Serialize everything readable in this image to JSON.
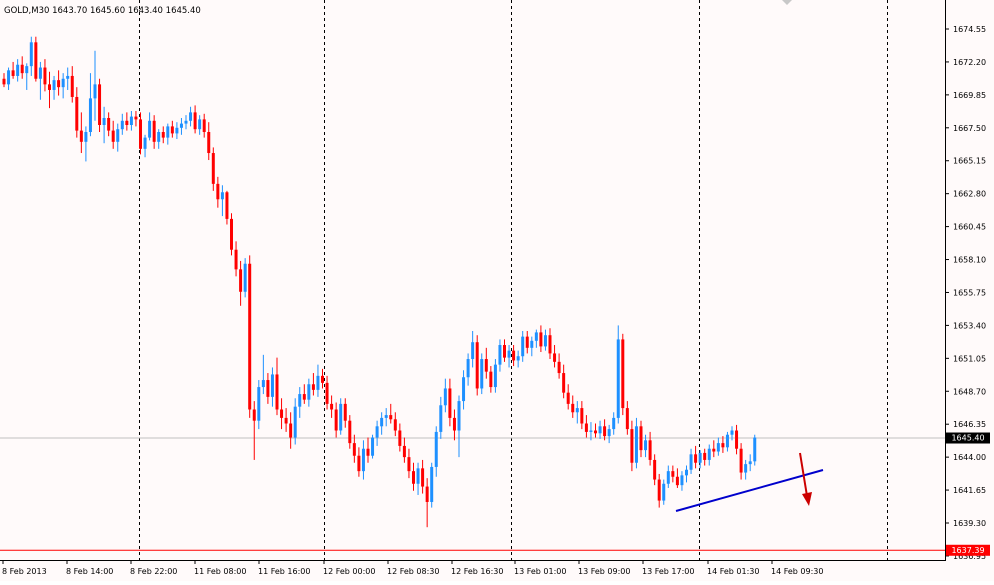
{
  "chart_data": {
    "type": "candlestick",
    "symbol_header": "GOLD,M30  1643.70 1645.60 1643.40 1645.40",
    "x_tick_labels": [
      "8 Feb 2013",
      "8 Feb 14:00",
      "8 Feb 22:00",
      "11 Feb 08:00",
      "11 Feb 16:00",
      "12 Feb 00:00",
      "12 Feb 08:30",
      "12 Feb 16:30",
      "13 Feb 01:00",
      "13 Feb 09:00",
      "13 Feb 17:00",
      "14 Feb 01:30",
      "14 Feb 09:30"
    ],
    "y_tick_labels": [
      "1674.55",
      "1672.20",
      "1669.85",
      "1667.50",
      "1665.15",
      "1662.80",
      "1660.45",
      "1658.10",
      "1655.75",
      "1653.40",
      "1651.05",
      "1648.70",
      "1646.35",
      "1644.00",
      "1641.65",
      "1639.30",
      "1636.95"
    ],
    "ylim": [
      1636.55,
      1676.1
    ],
    "current_price": 1645.4,
    "current_price_label": "1645.40",
    "red_level": 1637.39,
    "red_level_label": "1637.39",
    "grid": "vertical-dotted",
    "colors": {
      "background": "#fffafa",
      "bull": "#1e90ff",
      "bear": "#ff0000",
      "price_line": "#c0c0c0",
      "red_line": "#ff0000",
      "trendline": "#0000cc",
      "arrow": "#cc0000"
    },
    "candles": [
      [
        1671.0,
        1671.4,
        1670.4,
        1670.6
      ],
      [
        1670.6,
        1671.8,
        1670.2,
        1671.6
      ],
      [
        1671.6,
        1672.2,
        1671.0,
        1671.2
      ],
      [
        1671.2,
        1672.4,
        1670.8,
        1672.0
      ],
      [
        1672.0,
        1672.6,
        1671.0,
        1671.4
      ],
      [
        1671.4,
        1672.1,
        1670.2,
        1671.9
      ],
      [
        1671.9,
        1674.0,
        1671.2,
        1673.6
      ],
      [
        1673.6,
        1674.0,
        1670.8,
        1671.0
      ],
      [
        1671.0,
        1672.2,
        1669.5,
        1671.8
      ],
      [
        1671.8,
        1672.4,
        1670.1,
        1670.6
      ],
      [
        1670.6,
        1671.5,
        1668.9,
        1670.2
      ],
      [
        1670.2,
        1671.2,
        1669.5,
        1670.9
      ],
      [
        1670.9,
        1671.6,
        1669.8,
        1670.4
      ],
      [
        1670.4,
        1671.4,
        1669.6,
        1671.0
      ],
      [
        1671.0,
        1671.8,
        1670.2,
        1671.2
      ],
      [
        1671.2,
        1671.9,
        1669.3,
        1669.7
      ],
      [
        1669.7,
        1670.4,
        1666.8,
        1667.3
      ],
      [
        1667.3,
        1668.6,
        1665.7,
        1666.5
      ],
      [
        1666.5,
        1667.6,
        1665.1,
        1667.2
      ],
      [
        1667.2,
        1671.4,
        1666.9,
        1669.6
      ],
      [
        1669.6,
        1673.0,
        1668.0,
        1670.6
      ],
      [
        1670.6,
        1671.0,
        1667.2,
        1667.7
      ],
      [
        1667.7,
        1669.0,
        1666.4,
        1668.2
      ],
      [
        1668.2,
        1668.6,
        1666.9,
        1667.3
      ],
      [
        1667.3,
        1668.0,
        1666.0,
        1666.5
      ],
      [
        1666.5,
        1667.8,
        1665.8,
        1667.4
      ],
      [
        1667.4,
        1668.5,
        1667.0,
        1668.0
      ],
      [
        1668.0,
        1668.6,
        1667.3,
        1667.7
      ],
      [
        1667.7,
        1668.7,
        1667.3,
        1668.3
      ],
      [
        1668.3,
        1668.7,
        1667.6,
        1668.1
      ],
      [
        1668.1,
        1668.6,
        1665.6,
        1666.0
      ],
      [
        1666.0,
        1667.0,
        1665.4,
        1666.8
      ],
      [
        1666.8,
        1668.6,
        1666.6,
        1668.0
      ],
      [
        1668.0,
        1668.4,
        1666.0,
        1666.5
      ],
      [
        1666.5,
        1667.4,
        1666.0,
        1667.2
      ],
      [
        1667.2,
        1667.6,
        1666.4,
        1666.8
      ],
      [
        1666.8,
        1667.8,
        1666.3,
        1667.6
      ],
      [
        1667.6,
        1668.0,
        1666.8,
        1667.1
      ],
      [
        1667.1,
        1667.9,
        1666.7,
        1667.5
      ],
      [
        1667.5,
        1668.2,
        1667.0,
        1667.8
      ],
      [
        1667.8,
        1668.4,
        1667.4,
        1668.0
      ],
      [
        1668.0,
        1669.0,
        1667.6,
        1668.6
      ],
      [
        1668.6,
        1669.1,
        1667.1,
        1667.4
      ],
      [
        1667.4,
        1668.4,
        1667.0,
        1668.1
      ],
      [
        1668.1,
        1668.5,
        1666.8,
        1667.2
      ],
      [
        1667.2,
        1667.9,
        1665.2,
        1665.7
      ],
      [
        1665.7,
        1666.1,
        1663.0,
        1663.5
      ],
      [
        1663.5,
        1664.0,
        1661.8,
        1662.4
      ],
      [
        1662.4,
        1663.4,
        1661.2,
        1662.9
      ],
      [
        1662.9,
        1663.0,
        1660.6,
        1661.0
      ],
      [
        1661.0,
        1661.4,
        1658.4,
        1658.8
      ],
      [
        1658.8,
        1659.4,
        1656.9,
        1657.4
      ],
      [
        1657.4,
        1658.0,
        1654.8,
        1655.8
      ],
      [
        1655.8,
        1658.2,
        1655.4,
        1657.8
      ],
      [
        1657.8,
        1658.4,
        1646.8,
        1647.4
      ],
      [
        1647.4,
        1648.0,
        1643.8,
        1646.6
      ],
      [
        1646.6,
        1649.5,
        1646.0,
        1649.0
      ],
      [
        1649.0,
        1651.3,
        1648.5,
        1649.5
      ],
      [
        1649.5,
        1650.0,
        1647.8,
        1648.3
      ],
      [
        1648.3,
        1650.4,
        1647.6,
        1649.9
      ],
      [
        1649.9,
        1651.1,
        1647.0,
        1647.4
      ],
      [
        1647.4,
        1648.2,
        1646.0,
        1646.8
      ],
      [
        1646.8,
        1647.5,
        1645.8,
        1646.4
      ],
      [
        1646.4,
        1647.2,
        1644.6,
        1645.4
      ],
      [
        1645.4,
        1648.2,
        1644.9,
        1647.6
      ],
      [
        1647.6,
        1649.0,
        1646.8,
        1648.5
      ],
      [
        1648.5,
        1649.2,
        1647.8,
        1648.1
      ],
      [
        1648.1,
        1649.6,
        1647.6,
        1649.2
      ],
      [
        1649.2,
        1650.0,
        1648.4,
        1648.8
      ],
      [
        1648.8,
        1650.6,
        1648.3,
        1649.8
      ],
      [
        1649.8,
        1650.3,
        1648.9,
        1649.3
      ],
      [
        1649.3,
        1649.8,
        1647.4,
        1647.8
      ],
      [
        1647.8,
        1648.4,
        1646.8,
        1647.4
      ],
      [
        1647.4,
        1647.9,
        1645.4,
        1645.9
      ],
      [
        1645.9,
        1648.2,
        1645.6,
        1647.8
      ],
      [
        1647.8,
        1648.2,
        1646.1,
        1646.6
      ],
      [
        1646.6,
        1647.0,
        1644.6,
        1645.0
      ],
      [
        1645.0,
        1645.6,
        1643.6,
        1644.1
      ],
      [
        1644.1,
        1644.7,
        1642.6,
        1643.0
      ],
      [
        1643.0,
        1645.2,
        1642.4,
        1644.6
      ],
      [
        1644.6,
        1645.4,
        1643.6,
        1644.1
      ],
      [
        1644.1,
        1645.6,
        1643.9,
        1645.4
      ],
      [
        1645.4,
        1646.6,
        1644.8,
        1646.2
      ],
      [
        1646.2,
        1647.2,
        1645.6,
        1646.8
      ],
      [
        1646.8,
        1647.5,
        1646.2,
        1647.0
      ],
      [
        1647.0,
        1647.8,
        1646.4,
        1646.7
      ],
      [
        1646.7,
        1647.2,
        1645.5,
        1645.9
      ],
      [
        1645.9,
        1646.4,
        1644.4,
        1644.8
      ],
      [
        1644.8,
        1645.4,
        1643.6,
        1644.0
      ],
      [
        1644.0,
        1644.6,
        1642.5,
        1643.0
      ],
      [
        1643.0,
        1643.6,
        1641.6,
        1642.1
      ],
      [
        1642.1,
        1643.6,
        1641.3,
        1643.2
      ],
      [
        1643.2,
        1643.8,
        1641.4,
        1641.9
      ],
      [
        1641.9,
        1642.5,
        1639.0,
        1640.8
      ],
      [
        1640.8,
        1643.6,
        1640.4,
        1643.3
      ],
      [
        1643.3,
        1646.2,
        1642.6,
        1645.8
      ],
      [
        1645.8,
        1648.3,
        1645.3,
        1647.7
      ],
      [
        1647.7,
        1649.6,
        1647.2,
        1648.9
      ],
      [
        1648.9,
        1649.6,
        1646.2,
        1646.8
      ],
      [
        1646.8,
        1647.4,
        1645.2,
        1645.9
      ],
      [
        1645.9,
        1648.4,
        1644.0,
        1648.0
      ],
      [
        1648.0,
        1650.2,
        1647.4,
        1649.7
      ],
      [
        1649.7,
        1651.4,
        1649.1,
        1651.0
      ],
      [
        1651.0,
        1653.0,
        1650.4,
        1652.2
      ],
      [
        1652.2,
        1652.7,
        1648.4,
        1648.9
      ],
      [
        1648.9,
        1651.4,
        1648.5,
        1651.0
      ],
      [
        1651.0,
        1651.8,
        1649.6,
        1650.1
      ],
      [
        1650.1,
        1650.5,
        1648.6,
        1649.0
      ],
      [
        1649.0,
        1651.0,
        1648.6,
        1650.6
      ],
      [
        1650.6,
        1652.4,
        1650.1,
        1652.0
      ],
      [
        1652.0,
        1652.4,
        1650.8,
        1651.1
      ],
      [
        1651.1,
        1652.0,
        1650.4,
        1651.6
      ],
      [
        1651.6,
        1652.0,
        1650.5,
        1650.9
      ],
      [
        1650.9,
        1651.6,
        1650.4,
        1651.2
      ],
      [
        1651.2,
        1653.0,
        1650.8,
        1652.6
      ],
      [
        1652.6,
        1653.0,
        1651.4,
        1651.8
      ],
      [
        1651.8,
        1652.6,
        1651.2,
        1652.3
      ],
      [
        1652.3,
        1653.1,
        1651.8,
        1652.9
      ],
      [
        1652.9,
        1653.4,
        1651.5,
        1651.9
      ],
      [
        1651.9,
        1653.1,
        1651.6,
        1652.7
      ],
      [
        1652.7,
        1653.2,
        1651.0,
        1651.4
      ],
      [
        1651.4,
        1652.0,
        1650.4,
        1650.8
      ],
      [
        1650.8,
        1651.4,
        1649.6,
        1650.0
      ],
      [
        1650.0,
        1650.6,
        1648.2,
        1648.6
      ],
      [
        1648.6,
        1649.2,
        1647.4,
        1647.8
      ],
      [
        1647.8,
        1648.4,
        1646.8,
        1647.2
      ],
      [
        1647.2,
        1648.0,
        1646.4,
        1647.5
      ],
      [
        1647.5,
        1648.0,
        1646.0,
        1646.4
      ],
      [
        1646.4,
        1647.0,
        1645.4,
        1645.8
      ],
      [
        1645.8,
        1646.5,
        1645.2,
        1645.9
      ],
      [
        1645.9,
        1646.4,
        1645.4,
        1645.7
      ],
      [
        1645.7,
        1646.6,
        1645.3,
        1646.2
      ],
      [
        1646.2,
        1646.7,
        1645.2,
        1645.5
      ],
      [
        1645.5,
        1646.3,
        1645.0,
        1646.0
      ],
      [
        1646.0,
        1647.2,
        1645.6,
        1646.8
      ],
      [
        1646.8,
        1653.4,
        1646.4,
        1652.4
      ],
      [
        1652.4,
        1652.8,
        1647.0,
        1647.5
      ],
      [
        1647.5,
        1648.0,
        1645.6,
        1646.0
      ],
      [
        1646.0,
        1646.6,
        1643.0,
        1643.6
      ],
      [
        1643.6,
        1646.8,
        1643.2,
        1646.2
      ],
      [
        1646.2,
        1646.6,
        1644.0,
        1644.5
      ],
      [
        1644.5,
        1645.6,
        1644.0,
        1645.2
      ],
      [
        1645.2,
        1645.8,
        1643.4,
        1643.8
      ],
      [
        1643.8,
        1644.2,
        1642.0,
        1642.4
      ],
      [
        1642.4,
        1642.8,
        1640.4,
        1640.9
      ],
      [
        1640.9,
        1642.4,
        1640.6,
        1642.1
      ],
      [
        1642.1,
        1643.4,
        1641.8,
        1643.0
      ],
      [
        1643.0,
        1643.4,
        1642.2,
        1642.6
      ],
      [
        1642.6,
        1643.2,
        1641.8,
        1642.0
      ],
      [
        1642.0,
        1643.0,
        1641.6,
        1642.7
      ],
      [
        1642.7,
        1643.4,
        1642.2,
        1643.1
      ],
      [
        1643.1,
        1644.6,
        1642.8,
        1644.2
      ],
      [
        1644.2,
        1644.8,
        1643.2,
        1643.6
      ],
      [
        1643.6,
        1644.5,
        1643.2,
        1644.3
      ],
      [
        1644.3,
        1644.6,
        1643.4,
        1643.8
      ],
      [
        1643.8,
        1644.9,
        1643.4,
        1644.6
      ],
      [
        1644.6,
        1645.2,
        1644.0,
        1644.4
      ],
      [
        1644.4,
        1645.4,
        1644.1,
        1645.0
      ],
      [
        1645.0,
        1645.5,
        1644.3,
        1644.7
      ],
      [
        1644.7,
        1645.8,
        1644.4,
        1645.6
      ],
      [
        1645.6,
        1646.2,
        1645.2,
        1645.9
      ],
      [
        1645.9,
        1646.3,
        1644.2,
        1644.6
      ],
      [
        1644.6,
        1645.0,
        1642.4,
        1642.9
      ],
      [
        1642.9,
        1643.8,
        1642.4,
        1643.5
      ],
      [
        1643.5,
        1644.2,
        1643.0,
        1643.7
      ],
      [
        1643.7,
        1645.6,
        1643.4,
        1645.4
      ]
    ]
  }
}
